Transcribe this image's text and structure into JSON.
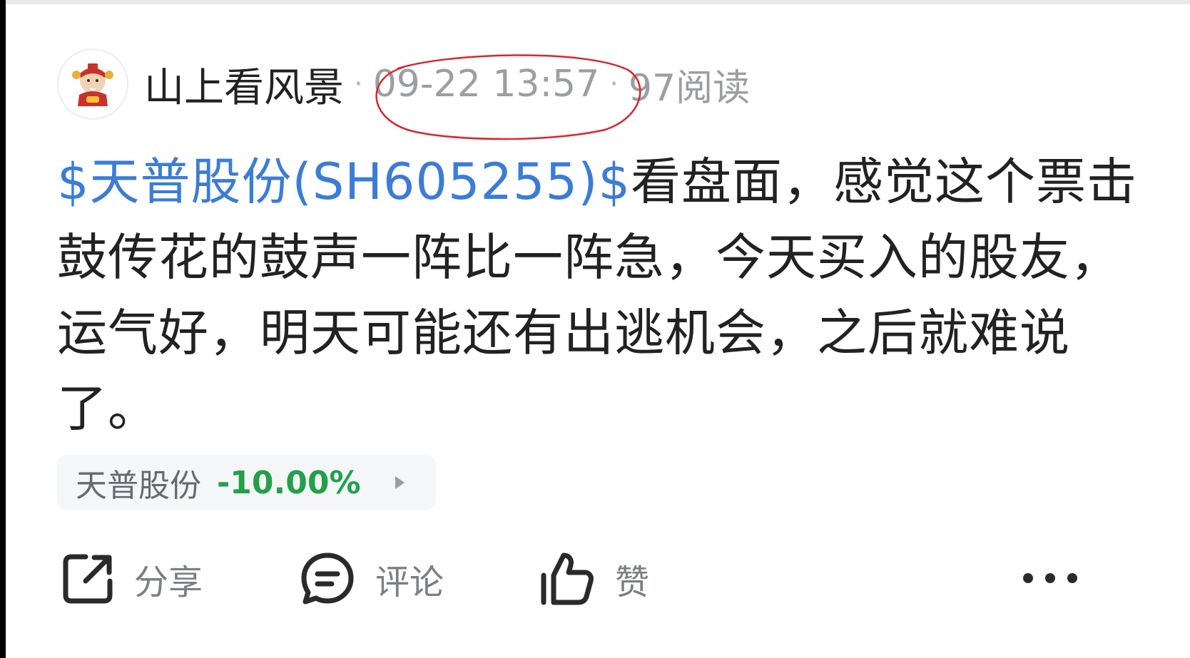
{
  "post": {
    "author": "山上看风景",
    "separator": "·",
    "time": "09-22 13:57",
    "reads": "97阅读",
    "content": {
      "stock_link": "$天普股份(SH605255)$",
      "text": "看盘面，感觉这个票击鼓传花的鼓声一阵比一阵急，今天买入的股友，运气好，明天可能还有出逃机会，之后就难说了。"
    },
    "stock_chip": {
      "name": "天普股份",
      "change": "-10.00%"
    }
  },
  "actions": {
    "share_label": "分享",
    "comment_label": "评论",
    "like_label": "赞"
  },
  "colors": {
    "link": "#3b7cd9",
    "down": "#22a04b",
    "annotation": "#d8262e",
    "text": "#222222",
    "muted": "#9c9ea3"
  },
  "icons": {
    "share": "share-icon",
    "comment": "comment-icon",
    "like": "thumbs-up-icon",
    "more": "more-icon",
    "chip_arrow": "triangle-right-icon"
  }
}
